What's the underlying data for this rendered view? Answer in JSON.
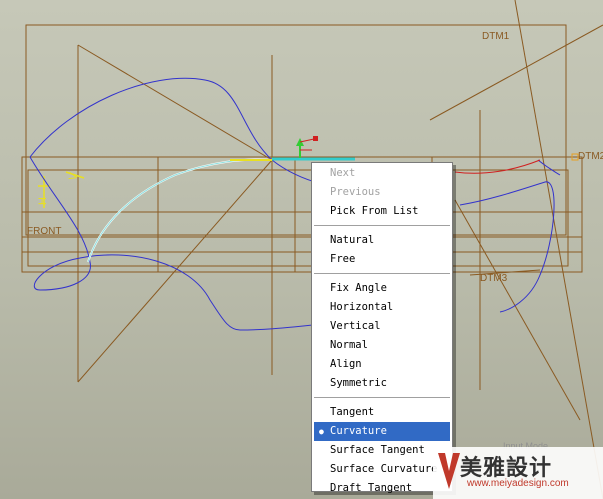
{
  "datum_labels": {
    "dtm1": "DTM1",
    "dtm2": "DTM2",
    "dtm3": "DTM3",
    "front": "FRONT",
    "h": "H",
    "v": "V"
  },
  "context_menu": {
    "items": [
      {
        "label": "Next",
        "enabled": false
      },
      {
        "label": "Previous",
        "enabled": false
      },
      {
        "label": "Pick From List",
        "enabled": true
      },
      {
        "label": "Natural",
        "enabled": true
      },
      {
        "label": "Free",
        "enabled": true
      },
      {
        "label": "Fix Angle",
        "enabled": true
      },
      {
        "label": "Horizontal",
        "enabled": true
      },
      {
        "label": "Vertical",
        "enabled": true
      },
      {
        "label": "Normal",
        "enabled": true
      },
      {
        "label": "Align",
        "enabled": true
      },
      {
        "label": "Symmetric",
        "enabled": true
      },
      {
        "label": "Tangent",
        "enabled": true
      },
      {
        "label": "Curvature",
        "enabled": true,
        "selected": true
      },
      {
        "label": "Surface Tangent",
        "enabled": true
      },
      {
        "label": "Surface Curvature",
        "enabled": true
      },
      {
        "label": "Draft Tangent",
        "enabled": true
      }
    ]
  },
  "status": {
    "input_mode": "Input Mode"
  },
  "watermark": {
    "text": "美雅設计",
    "url": "www.meiyadesign.com"
  },
  "colors": {
    "datum_lines": "#8a5a22",
    "curve": "#3333cc",
    "selection_highlight": "#316ac5",
    "tangent_handle": "#33cccc",
    "axis_marker": "#e8e020"
  }
}
